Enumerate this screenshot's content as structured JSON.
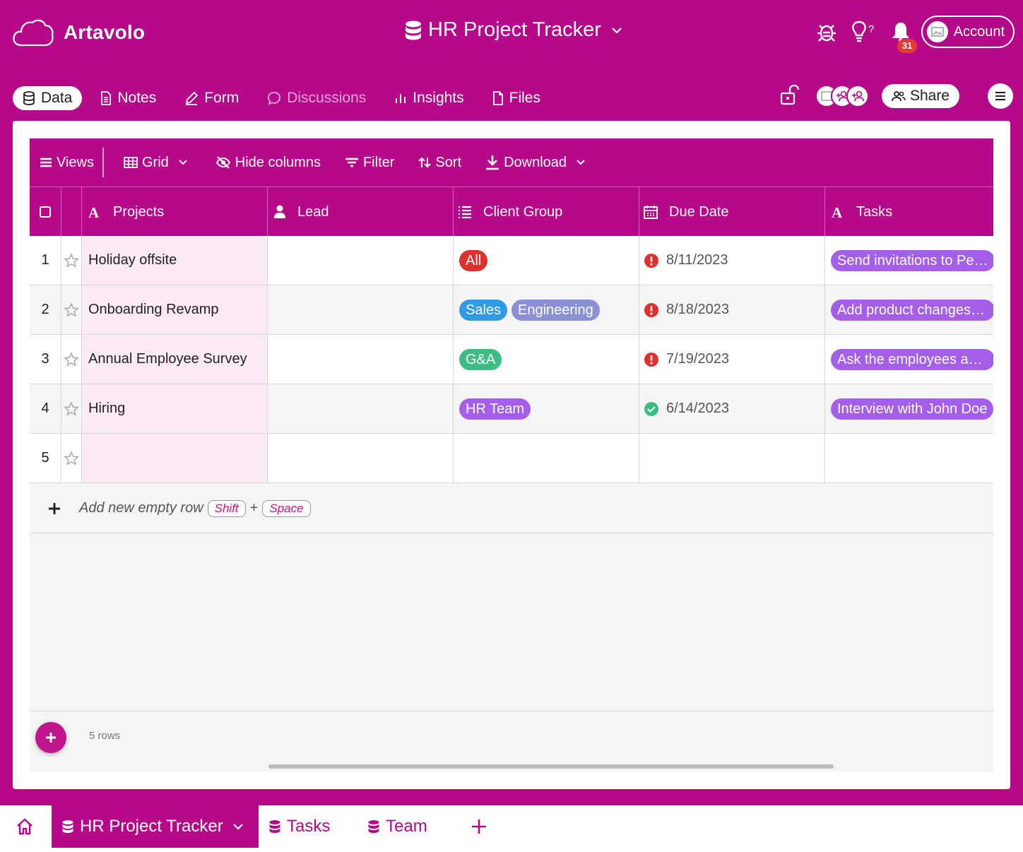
{
  "header": {
    "brand": "Artavolo",
    "title": "HR Project Tracker",
    "notification_count": "31",
    "account_label": "Account"
  },
  "tabs": [
    {
      "label": "Data",
      "icon": "database-icon",
      "active": true
    },
    {
      "label": "Notes",
      "icon": "document-icon"
    },
    {
      "label": "Form",
      "icon": "pencil-icon"
    },
    {
      "label": "Discussions",
      "icon": "chat-icon",
      "muted": true
    },
    {
      "label": "Insights",
      "icon": "bar-chart-icon"
    },
    {
      "label": "Files",
      "icon": "file-icon"
    }
  ],
  "share_label": "Share",
  "toolbar": {
    "views": "Views",
    "grid": "Grid",
    "hide_columns": "Hide columns",
    "filter": "Filter",
    "sort": "Sort",
    "download": "Download"
  },
  "columns": [
    {
      "label": "Projects",
      "icon": "text-icon"
    },
    {
      "label": "Lead",
      "icon": "person-icon"
    },
    {
      "label": "Client Group",
      "icon": "list-icon"
    },
    {
      "label": "Due Date",
      "icon": "calendar-icon"
    },
    {
      "label": "Tasks",
      "icon": "text-icon"
    }
  ],
  "rows": [
    {
      "num": "1",
      "project": "Holiday offsite",
      "lead": "",
      "groups": [
        {
          "label": "All",
          "color": "#e0302e"
        }
      ],
      "due": "8/11/2023",
      "status": "overdue",
      "task": "Send invitations to People"
    },
    {
      "num": "2",
      "project": "Onboarding Revamp",
      "lead": "",
      "groups": [
        {
          "label": "Sales",
          "color": "#2f9be6"
        },
        {
          "label": "Engineering",
          "color": "#8a8fd6"
        }
      ],
      "due": "8/18/2023",
      "status": "overdue",
      "task": "Add product changes to the guide"
    },
    {
      "num": "3",
      "project": "Annual Employee Survey",
      "lead": "",
      "groups": [
        {
          "label": "G&A",
          "color": "#3dbc83"
        }
      ],
      "due": "7/19/2023",
      "status": "overdue",
      "task": "Ask the employees about benefits"
    },
    {
      "num": "4",
      "project": "Hiring",
      "lead": "",
      "groups": [
        {
          "label": "HR Team",
          "color": "#a55eea"
        }
      ],
      "due": "6/14/2023",
      "status": "done",
      "task": "Interview with John Doe"
    },
    {
      "num": "5",
      "project": "",
      "lead": "",
      "groups": [],
      "due": "",
      "status": "",
      "task": ""
    }
  ],
  "add_row": {
    "label": "Add new empty row",
    "key1": "Shift",
    "plus": "+",
    "key2": "Space"
  },
  "row_count": "5 rows",
  "bottom_tabs": [
    {
      "label": "HR Project Tracker",
      "active": true
    },
    {
      "label": "Tasks"
    },
    {
      "label": "Team"
    }
  ],
  "colors": {
    "brand": "#b5098a",
    "overdue": "#e0302e",
    "done": "#3dbc83",
    "task_chip": "#a55eea"
  }
}
